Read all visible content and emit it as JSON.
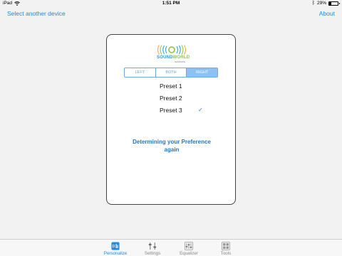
{
  "status_bar": {
    "device": "iPad",
    "time": "1:51 PM",
    "battery_text": "29%",
    "battery_level": 0.29,
    "icons": [
      "wifi-icon",
      "bluetooth-icon",
      "battery-icon"
    ]
  },
  "nav": {
    "left_label": "Select another device",
    "right_label": "About"
  },
  "card": {
    "logo": {
      "brand_sound": "SOUND",
      "brand_world": "WORLD",
      "brand_sub": "solutions"
    },
    "segments": [
      {
        "label": "LEFT",
        "active": false
      },
      {
        "label": "BOTH",
        "active": false
      },
      {
        "label": "RIGHT",
        "active": true
      }
    ],
    "presets": [
      {
        "label": "Preset 1",
        "check": ""
      },
      {
        "label": "Preset 2",
        "check": ""
      },
      {
        "label": "Preset 3",
        "check": "✓"
      }
    ],
    "message_line1": "Determining your Preference",
    "message_line2": "again"
  },
  "tabs": [
    {
      "label": "Personalize",
      "icon": "personalize-icon",
      "active": true
    },
    {
      "label": "Settings",
      "icon": "settings-icon",
      "active": false
    },
    {
      "label": "Equalizer",
      "icon": "equalizer-icon",
      "active": false
    },
    {
      "label": "Tools",
      "icon": "tools-icon",
      "active": false
    }
  ],
  "colors": {
    "accent": "#1e88e5",
    "segment_active": "#8ec0f2",
    "brand_blue": "#1e9be0",
    "brand_green": "#8cc63f"
  }
}
